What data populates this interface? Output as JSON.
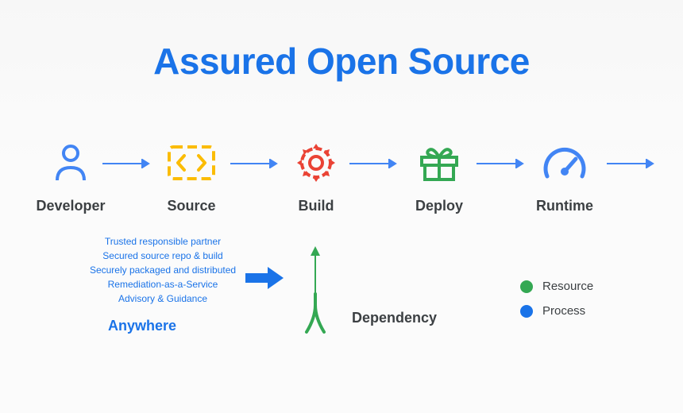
{
  "title": "Assured Open Source",
  "stages": {
    "developer": "Developer",
    "source": "Source",
    "build": "Build",
    "deploy": "Deploy",
    "runtime": "Runtime"
  },
  "bullets": [
    "Trusted responsible partner",
    "Secured source repo & build",
    "Securely packaged and distributed",
    "Remediation-as-a-Service",
    "Advisory & Guidance"
  ],
  "anywhere": "Anywhere",
  "dependency": "Dependency",
  "legend": {
    "resource": {
      "label": "Resource",
      "color": "#34a853"
    },
    "process": {
      "label": "Process",
      "color": "#1a73e8"
    }
  },
  "colors": {
    "title": "#1a73e8",
    "developer_icon": "#4285f4",
    "source_icon": "#fbbc04",
    "build_icon": "#ea4335",
    "deploy_icon": "#34a853",
    "runtime_icon": "#4285f4",
    "arrow": "#4285f4"
  },
  "chart_data": {
    "type": "flow-diagram",
    "title": "Assured Open Source",
    "nodes": [
      {
        "id": "developer",
        "label": "Developer",
        "icon": "person",
        "color": "#4285f4"
      },
      {
        "id": "source",
        "label": "Source",
        "icon": "code-brackets",
        "color": "#fbbc04"
      },
      {
        "id": "build",
        "label": "Build",
        "icon": "gear",
        "color": "#ea4335"
      },
      {
        "id": "deploy",
        "label": "Deploy",
        "icon": "gift",
        "color": "#34a853"
      },
      {
        "id": "runtime",
        "label": "Runtime",
        "icon": "gauge",
        "color": "#4285f4"
      },
      {
        "id": "anywhere",
        "label": "Anywhere",
        "annotations": [
          "Trusted responsible partner",
          "Secured source repo & build",
          "Securely packaged and distributed",
          "Remediation-as-a-Service",
          "Advisory & Guidance"
        ]
      },
      {
        "id": "dependency",
        "label": "Dependency",
        "icon": "merge",
        "color": "#34a853"
      }
    ],
    "edges": [
      {
        "from": "developer",
        "to": "source"
      },
      {
        "from": "source",
        "to": "build"
      },
      {
        "from": "build",
        "to": "deploy"
      },
      {
        "from": "deploy",
        "to": "runtime"
      },
      {
        "from": "runtime",
        "to": "out"
      },
      {
        "from": "anywhere",
        "to": "build"
      },
      {
        "from": "dependency",
        "to": "build"
      }
    ],
    "legend": [
      {
        "label": "Resource",
        "color": "#34a853"
      },
      {
        "label": "Process",
        "color": "#1a73e8"
      }
    ]
  }
}
